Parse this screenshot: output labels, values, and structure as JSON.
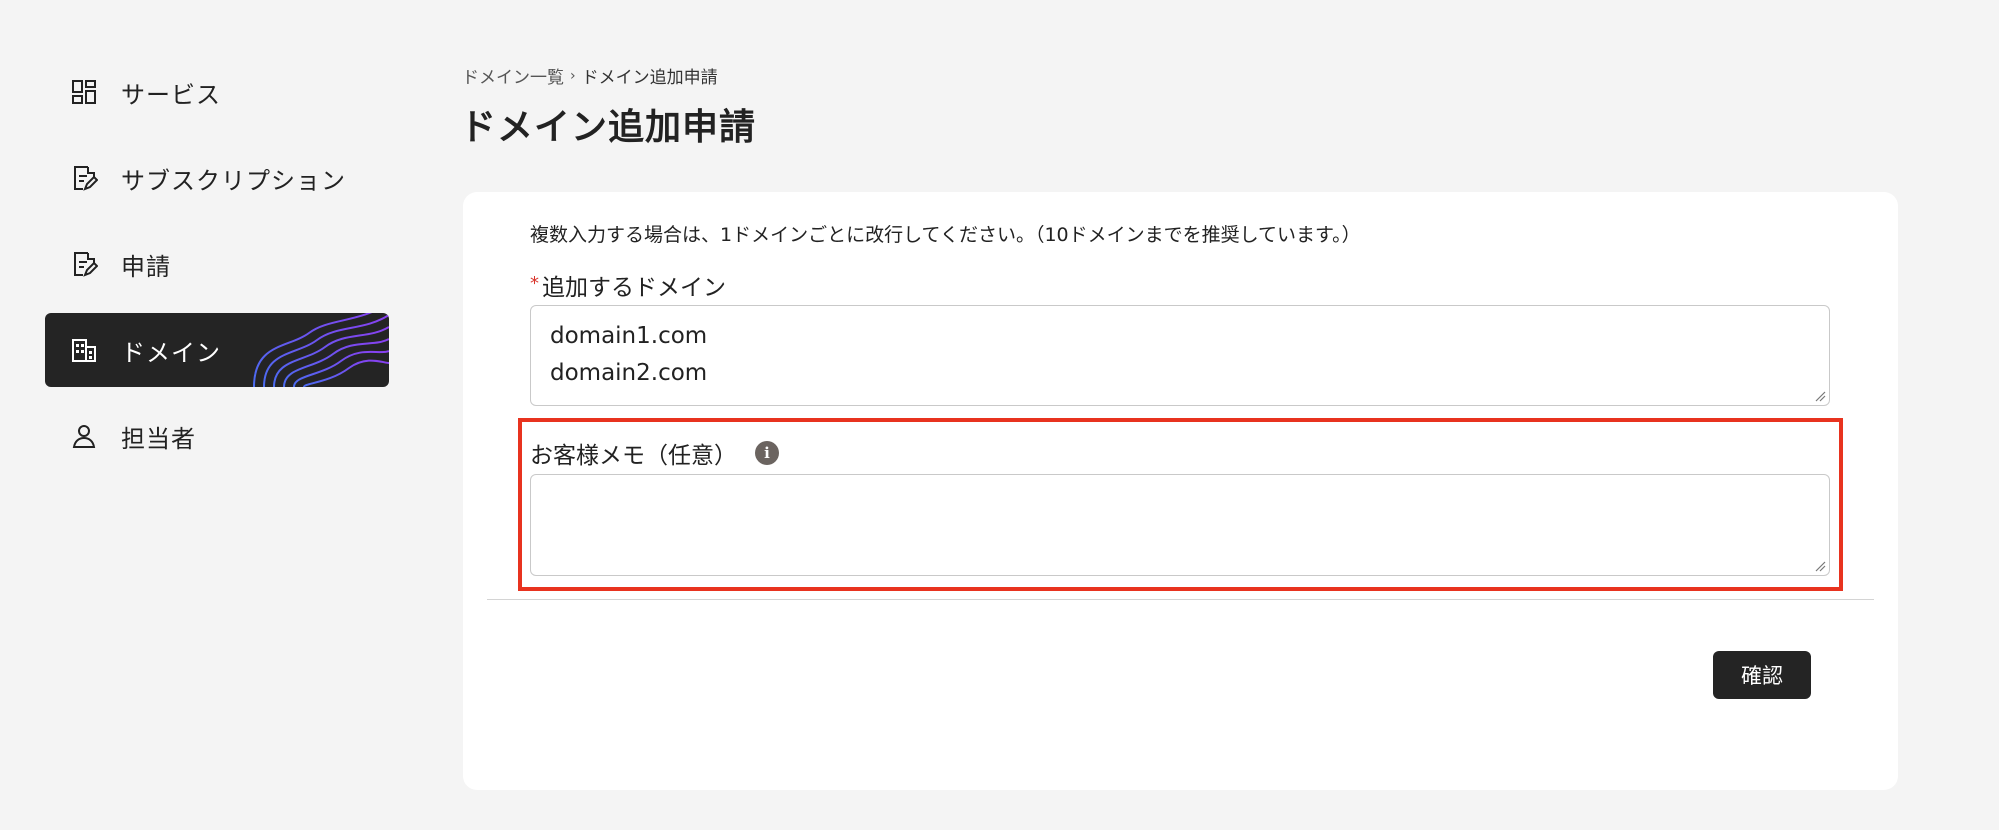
{
  "sidebar": {
    "items": [
      {
        "label": "サービス",
        "icon": "dashboard-grid-icon",
        "active": false
      },
      {
        "label": "サブスクリプション",
        "icon": "document-edit-icon",
        "active": false
      },
      {
        "label": "申請",
        "icon": "document-edit-icon",
        "active": false
      },
      {
        "label": "ドメイン",
        "icon": "building-icon",
        "active": true
      },
      {
        "label": "担当者",
        "icon": "person-icon",
        "active": false
      }
    ]
  },
  "breadcrumb": {
    "parent": "ドメイン一覧",
    "separator": "›",
    "current": "ドメイン追加申請"
  },
  "page": {
    "title": "ドメイン追加申請"
  },
  "form": {
    "hint": "複数入力する場合は、1ドメインごとに改行してください。（10ドメインまでを推奨しています。）",
    "domains": {
      "required_mark": "*",
      "label": "追加するドメイン",
      "lines": [
        "domain1.com",
        "domain2.com"
      ]
    },
    "memo": {
      "label": "お客様メモ（任意）",
      "info_icon": "i",
      "value": ""
    },
    "confirm_label": "確認"
  },
  "colors": {
    "active_nav_bg": "#242424",
    "highlight": "#e8331f",
    "required": "#d9342b",
    "button_bg": "#242424"
  }
}
